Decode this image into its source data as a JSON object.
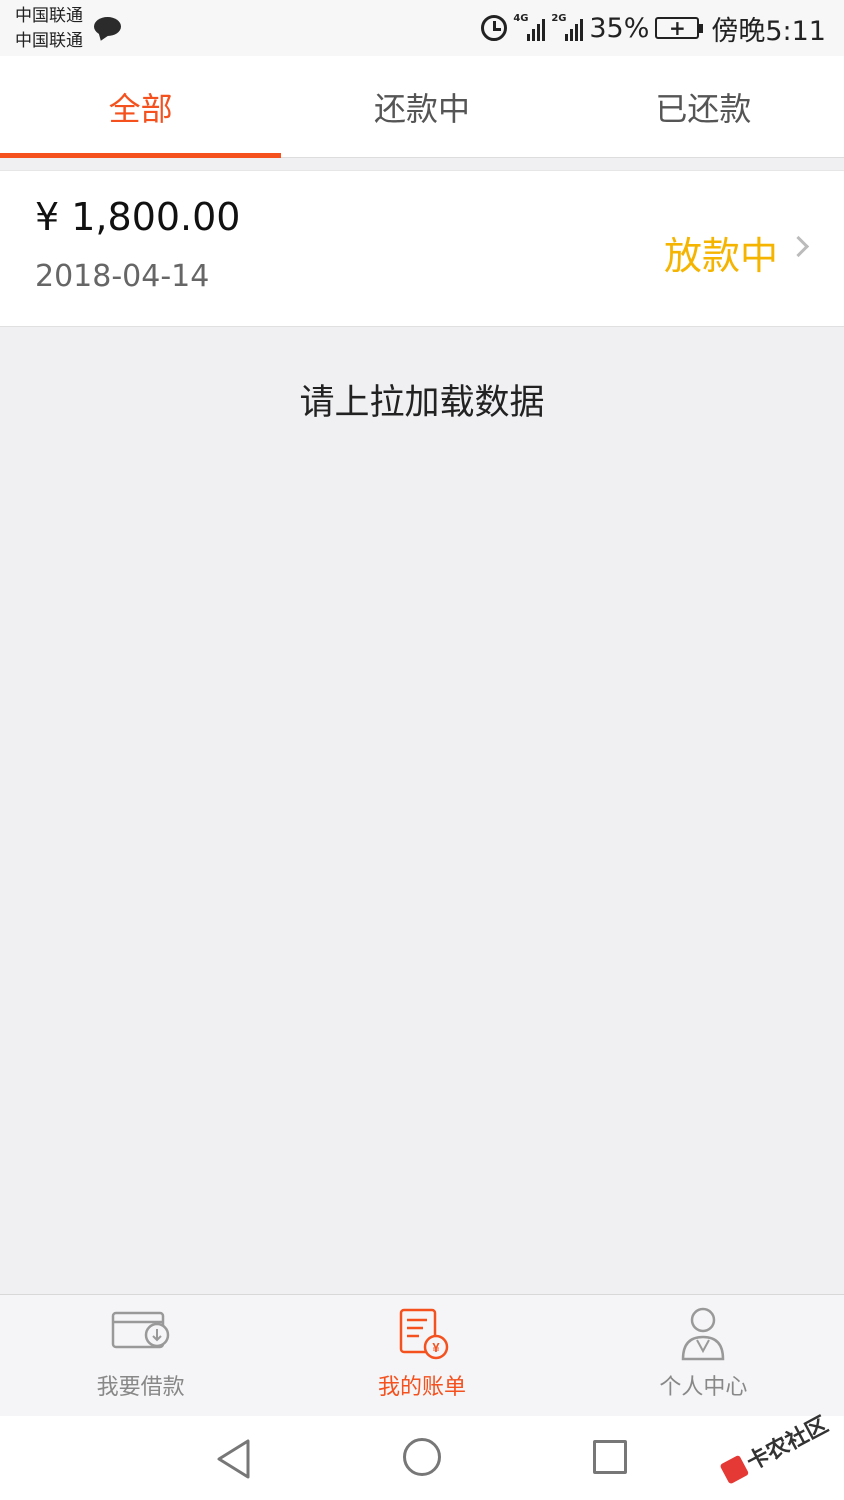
{
  "status_bar": {
    "carrier_1": "中国联通",
    "carrier_2": "中国联通",
    "network_1": "4G",
    "network_2": "2G",
    "battery_percent": "35%",
    "battery_symbol": "+",
    "time": "傍晚5:11"
  },
  "tabs": [
    {
      "label": "全部",
      "active": true
    },
    {
      "label": "还款中",
      "active": false
    },
    {
      "label": "已还款",
      "active": false
    }
  ],
  "loan": {
    "amount": "¥ 1,800.00",
    "date": "2018-04-14",
    "status": "放款中"
  },
  "load_hint": "请上拉加载数据",
  "bottom_nav": [
    {
      "label": "我要借款",
      "icon": "wallet-download-icon",
      "active": false
    },
    {
      "label": "我的账单",
      "icon": "bill-yuan-icon",
      "active": true
    },
    {
      "label": "个人中心",
      "icon": "person-icon",
      "active": false
    }
  ],
  "watermark": "卡农社区",
  "colors": {
    "accent": "#f4511e",
    "status_pending": "#f5b400",
    "background": "#f0f0f3"
  }
}
